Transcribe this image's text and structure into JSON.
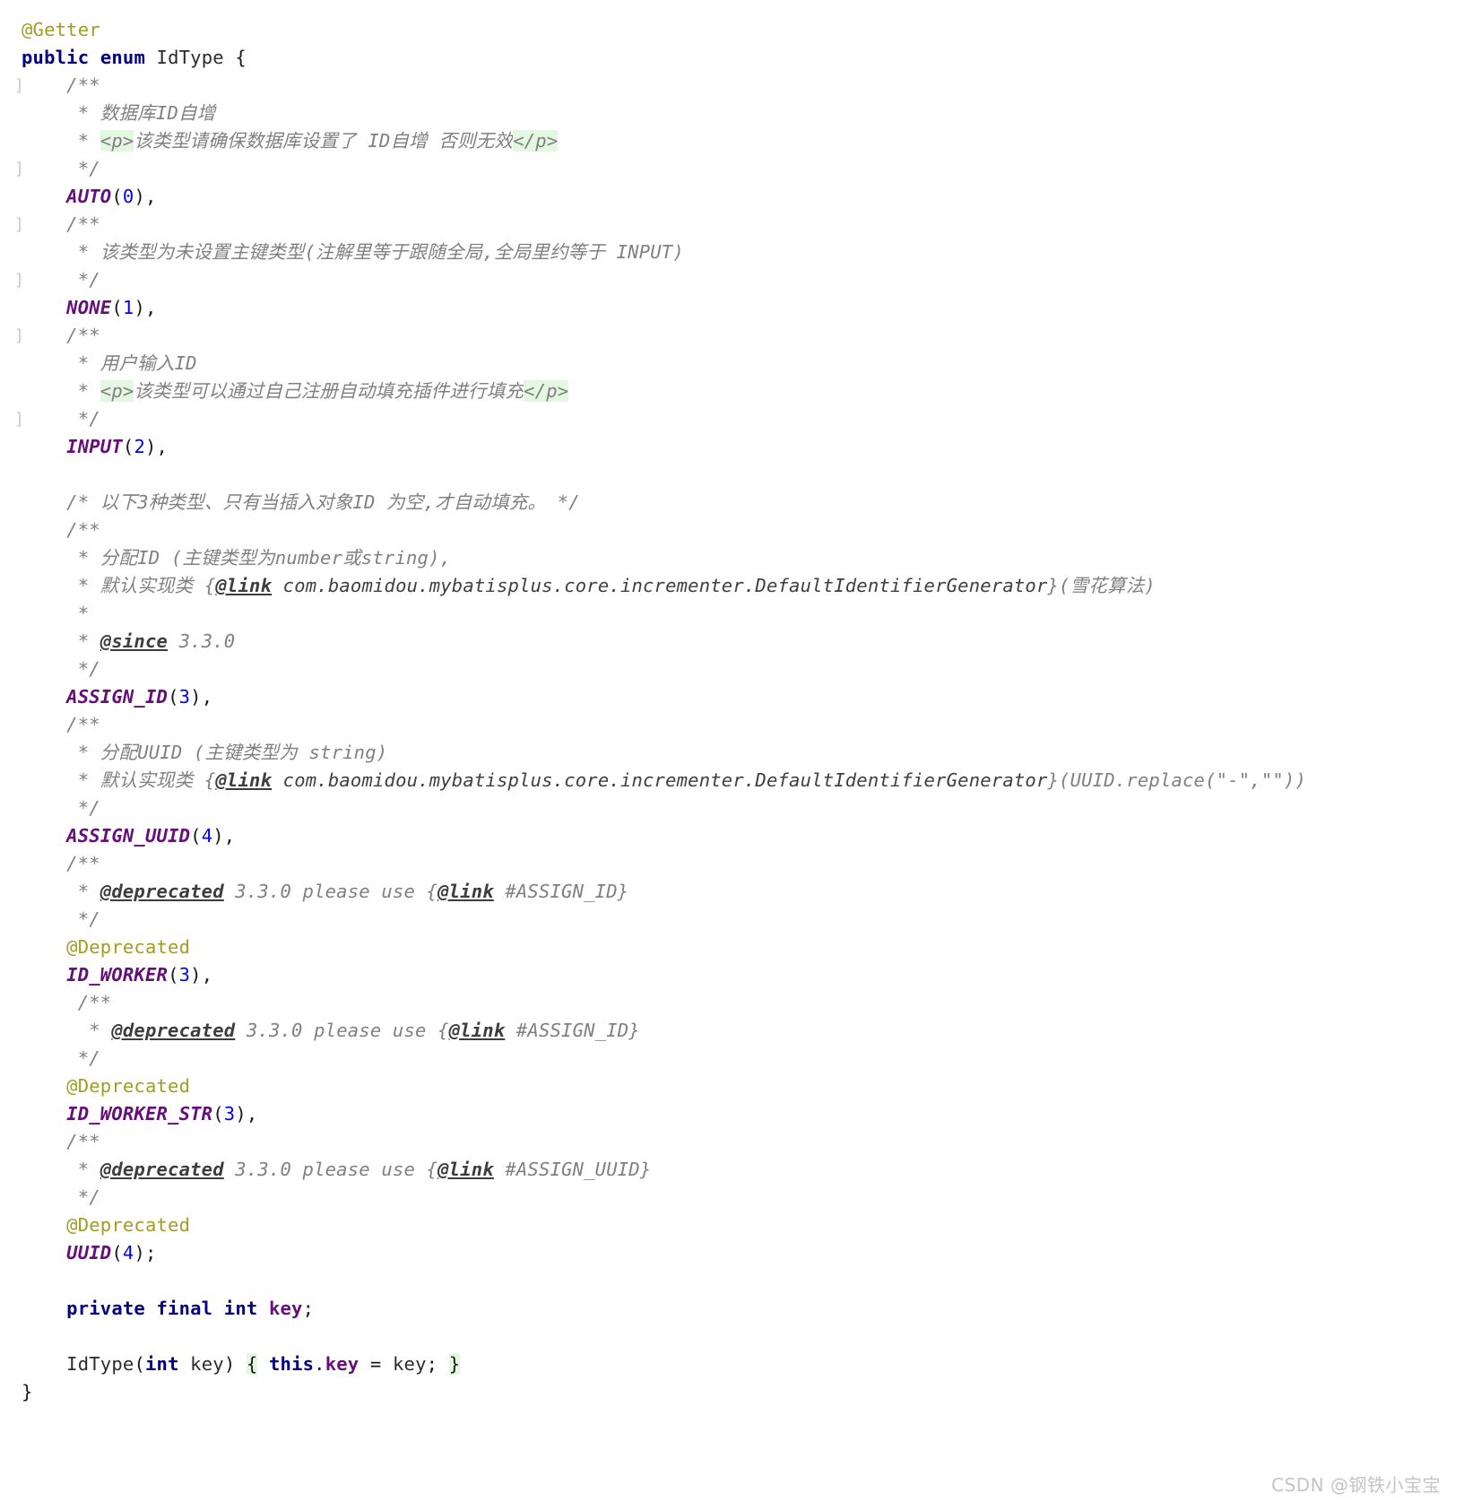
{
  "editor": {
    "language": "Java",
    "background_color": "#ffffff",
    "colors": {
      "keyword": "#000080",
      "annotation": "#9e9e20",
      "enum_constant": "#660e7a",
      "number": "#0000ff",
      "comment": "#808080",
      "field": "#660e7a",
      "brace_match_highlight": "#e4f7e0",
      "fold_marker": "#c9c9c9",
      "watermark": "#c4c4c4"
    }
  },
  "watermark": "CSDN @钢铁小宝宝",
  "code_lines": [
    {
      "fold": "",
      "tokens": [
        {
          "t": "@Getter",
          "c": "ann"
        }
      ]
    },
    {
      "fold": "",
      "tokens": [
        {
          "t": "public",
          "c": "kw"
        },
        {
          "t": " "
        },
        {
          "t": "enum",
          "c": "kw"
        },
        {
          "t": " "
        },
        {
          "t": "IdType",
          "c": "cls"
        },
        {
          "t": " "
        },
        {
          "t": "{",
          "c": "punc"
        }
      ]
    },
    {
      "fold": "]",
      "tokens": [
        {
          "t": "    "
        },
        {
          "t": "/**",
          "c": "cmt"
        }
      ]
    },
    {
      "fold": "",
      "tokens": [
        {
          "t": "     * ",
          "c": "cmt"
        },
        {
          "t": "数据库ID自增",
          "c": "cmt"
        }
      ]
    },
    {
      "fold": "",
      "tokens": [
        {
          "t": "     * ",
          "c": "cmt"
        },
        {
          "t": "<p>",
          "c": "cmt hl"
        },
        {
          "t": "该类型请确保数据库设置了 ID自增 否则无效",
          "c": "cmt"
        },
        {
          "t": "</p>",
          "c": "cmt hl"
        }
      ]
    },
    {
      "fold": "]",
      "tokens": [
        {
          "t": "     */",
          "c": "cmt"
        }
      ]
    },
    {
      "fold": "",
      "tokens": [
        {
          "t": "    "
        },
        {
          "t": "AUTO",
          "c": "enumc"
        },
        {
          "t": "(",
          "c": "punc"
        },
        {
          "t": "0",
          "c": "num"
        },
        {
          "t": "),",
          "c": "punc"
        }
      ]
    },
    {
      "fold": "]",
      "tokens": [
        {
          "t": "    "
        },
        {
          "t": "/**",
          "c": "cmt"
        }
      ]
    },
    {
      "fold": "",
      "tokens": [
        {
          "t": "     * ",
          "c": "cmt"
        },
        {
          "t": "该类型为未设置主键类型(注解里等于跟随全局,全局里约等于 INPUT)",
          "c": "cmt"
        }
      ]
    },
    {
      "fold": "]",
      "tokens": [
        {
          "t": "     */",
          "c": "cmt"
        }
      ]
    },
    {
      "fold": "",
      "tokens": [
        {
          "t": "    "
        },
        {
          "t": "NONE",
          "c": "enumc"
        },
        {
          "t": "(",
          "c": "punc"
        },
        {
          "t": "1",
          "c": "num"
        },
        {
          "t": "),",
          "c": "punc"
        }
      ]
    },
    {
      "fold": "]",
      "tokens": [
        {
          "t": "    "
        },
        {
          "t": "/**",
          "c": "cmt"
        }
      ]
    },
    {
      "fold": "",
      "tokens": [
        {
          "t": "     * ",
          "c": "cmt"
        },
        {
          "t": "用户输入ID",
          "c": "cmt"
        }
      ]
    },
    {
      "fold": "",
      "tokens": [
        {
          "t": "     * ",
          "c": "cmt"
        },
        {
          "t": "<p>",
          "c": "cmt hl"
        },
        {
          "t": "该类型可以通过自己注册自动填充插件进行填充",
          "c": "cmt"
        },
        {
          "t": "</p>",
          "c": "cmt hl"
        }
      ]
    },
    {
      "fold": "]",
      "tokens": [
        {
          "t": "     */",
          "c": "cmt"
        }
      ]
    },
    {
      "fold": "",
      "tokens": [
        {
          "t": "    "
        },
        {
          "t": "INPUT",
          "c": "enumc"
        },
        {
          "t": "(",
          "c": "punc"
        },
        {
          "t": "2",
          "c": "num"
        },
        {
          "t": "),",
          "c": "punc"
        }
      ]
    },
    {
      "fold": "",
      "tokens": [
        {
          "t": " "
        }
      ]
    },
    {
      "fold": "",
      "tokens": [
        {
          "t": "    /* 以下3种类型、只有当插入对象ID 为空,才自动填充。 */",
          "c": "cmt"
        }
      ]
    },
    {
      "fold": "",
      "tokens": [
        {
          "t": "    /**",
          "c": "cmt"
        }
      ]
    },
    {
      "fold": "",
      "tokens": [
        {
          "t": "     * ",
          "c": "cmt"
        },
        {
          "t": "分配ID (主键类型为number或string),",
          "c": "cmt"
        }
      ]
    },
    {
      "fold": "",
      "tokens": [
        {
          "t": "     * ",
          "c": "cmt"
        },
        {
          "t": "默认实现类 {",
          "c": "cmt"
        },
        {
          "t": "@link",
          "c": "cmtTag"
        },
        {
          "t": " com.baomidou.mybatisplus.core.incrementer.DefaultIdentifierGenerator",
          "c": "cmtCode"
        },
        {
          "t": "}(雪花算法)",
          "c": "cmt"
        }
      ]
    },
    {
      "fold": "",
      "tokens": [
        {
          "t": "     *",
          "c": "cmt"
        }
      ]
    },
    {
      "fold": "",
      "tokens": [
        {
          "t": "     * ",
          "c": "cmt"
        },
        {
          "t": "@since",
          "c": "cmtTag"
        },
        {
          "t": " 3.3.0",
          "c": "cmt"
        }
      ]
    },
    {
      "fold": "",
      "tokens": [
        {
          "t": "     */",
          "c": "cmt"
        }
      ]
    },
    {
      "fold": "",
      "tokens": [
        {
          "t": "    "
        },
        {
          "t": "ASSIGN_ID",
          "c": "enumc"
        },
        {
          "t": "(",
          "c": "punc"
        },
        {
          "t": "3",
          "c": "num"
        },
        {
          "t": "),",
          "c": "punc"
        }
      ]
    },
    {
      "fold": "",
      "tokens": [
        {
          "t": "    /**",
          "c": "cmt"
        }
      ]
    },
    {
      "fold": "",
      "tokens": [
        {
          "t": "     * ",
          "c": "cmt"
        },
        {
          "t": "分配UUID (主键类型为 string)",
          "c": "cmt"
        }
      ]
    },
    {
      "fold": "",
      "tokens": [
        {
          "t": "     * ",
          "c": "cmt"
        },
        {
          "t": "默认实现类 {",
          "c": "cmt"
        },
        {
          "t": "@link",
          "c": "cmtTag"
        },
        {
          "t": " com.baomidou.mybatisplus.core.incrementer.DefaultIdentifierGenerator",
          "c": "cmtCode"
        },
        {
          "t": "}(UUID.replace(\"-\",\"\"))",
          "c": "cmt"
        }
      ]
    },
    {
      "fold": "",
      "tokens": [
        {
          "t": "     */",
          "c": "cmt"
        }
      ]
    },
    {
      "fold": "",
      "tokens": [
        {
          "t": "    "
        },
        {
          "t": "ASSIGN_UUID",
          "c": "enumc"
        },
        {
          "t": "(",
          "c": "punc"
        },
        {
          "t": "4",
          "c": "num"
        },
        {
          "t": "),",
          "c": "punc"
        }
      ]
    },
    {
      "fold": "",
      "tokens": [
        {
          "t": "    /**",
          "c": "cmt"
        }
      ]
    },
    {
      "fold": "",
      "tokens": [
        {
          "t": "     * ",
          "c": "cmt"
        },
        {
          "t": "@deprecated",
          "c": "cmtTag"
        },
        {
          "t": " 3.3.0 please use {",
          "c": "cmt"
        },
        {
          "t": "@link",
          "c": "cmtTag"
        },
        {
          "t": " #ASSIGN_ID}",
          "c": "cmt"
        }
      ]
    },
    {
      "fold": "",
      "tokens": [
        {
          "t": "     */",
          "c": "cmt"
        }
      ]
    },
    {
      "fold": "",
      "tokens": [
        {
          "t": "    "
        },
        {
          "t": "@Deprecated",
          "c": "ann"
        }
      ]
    },
    {
      "fold": "",
      "tokens": [
        {
          "t": "    "
        },
        {
          "t": "ID_WORKER",
          "c": "enumc"
        },
        {
          "t": "(",
          "c": "punc"
        },
        {
          "t": "3",
          "c": "num"
        },
        {
          "t": "),",
          "c": "punc"
        }
      ]
    },
    {
      "fold": "",
      "tokens": [
        {
          "t": "     /**",
          "c": "cmt"
        }
      ]
    },
    {
      "fold": "",
      "tokens": [
        {
          "t": "      * ",
          "c": "cmt"
        },
        {
          "t": "@deprecated",
          "c": "cmtTag"
        },
        {
          "t": " 3.3.0 please use {",
          "c": "cmt"
        },
        {
          "t": "@link",
          "c": "cmtTag"
        },
        {
          "t": " #ASSIGN_ID}",
          "c": "cmt"
        }
      ]
    },
    {
      "fold": "",
      "tokens": [
        {
          "t": "     */",
          "c": "cmt"
        }
      ]
    },
    {
      "fold": "",
      "tokens": [
        {
          "t": "    "
        },
        {
          "t": "@Deprecated",
          "c": "ann"
        }
      ]
    },
    {
      "fold": "",
      "tokens": [
        {
          "t": "    "
        },
        {
          "t": "ID_WORKER_STR",
          "c": "enumc"
        },
        {
          "t": "(",
          "c": "punc"
        },
        {
          "t": "3",
          "c": "num"
        },
        {
          "t": "),",
          "c": "punc"
        }
      ]
    },
    {
      "fold": "",
      "tokens": [
        {
          "t": "    /**",
          "c": "cmt"
        }
      ]
    },
    {
      "fold": "",
      "tokens": [
        {
          "t": "     * ",
          "c": "cmt"
        },
        {
          "t": "@deprecated",
          "c": "cmtTag"
        },
        {
          "t": " 3.3.0 please use {",
          "c": "cmt"
        },
        {
          "t": "@link",
          "c": "cmtTag"
        },
        {
          "t": " #ASSIGN_UUID}",
          "c": "cmt"
        }
      ]
    },
    {
      "fold": "",
      "tokens": [
        {
          "t": "     */",
          "c": "cmt"
        }
      ]
    },
    {
      "fold": "",
      "tokens": [
        {
          "t": "    "
        },
        {
          "t": "@Deprecated",
          "c": "ann"
        }
      ]
    },
    {
      "fold": "",
      "tokens": [
        {
          "t": "    "
        },
        {
          "t": "UUID",
          "c": "enumc"
        },
        {
          "t": "(",
          "c": "punc"
        },
        {
          "t": "4",
          "c": "num"
        },
        {
          "t": ");",
          "c": "punc"
        }
      ]
    },
    {
      "fold": "",
      "tokens": [
        {
          "t": " "
        }
      ]
    },
    {
      "fold": "",
      "tokens": [
        {
          "t": "    "
        },
        {
          "t": "private",
          "c": "kw"
        },
        {
          "t": " "
        },
        {
          "t": "final",
          "c": "kw"
        },
        {
          "t": " "
        },
        {
          "t": "int",
          "c": "kw"
        },
        {
          "t": " "
        },
        {
          "t": "key",
          "c": "field"
        },
        {
          "t": ";",
          "c": "punc"
        }
      ]
    },
    {
      "fold": "",
      "tokens": [
        {
          "t": " "
        }
      ]
    },
    {
      "fold": "",
      "tokens": [
        {
          "t": "    "
        },
        {
          "t": "IdType",
          "c": "ident"
        },
        {
          "t": "(",
          "c": "punc"
        },
        {
          "t": "int",
          "c": "kw"
        },
        {
          "t": " "
        },
        {
          "t": "key",
          "c": "ident"
        },
        {
          "t": ") ",
          "c": "punc"
        },
        {
          "t": "{",
          "c": "punc hl"
        },
        {
          "t": " "
        },
        {
          "t": "this",
          "c": "kw"
        },
        {
          "t": ".",
          "c": "punc"
        },
        {
          "t": "key",
          "c": "field"
        },
        {
          "t": " = ",
          "c": "punc"
        },
        {
          "t": "key",
          "c": "ident"
        },
        {
          "t": "; ",
          "c": "punc"
        },
        {
          "t": "}",
          "c": "punc hl"
        }
      ]
    },
    {
      "fold": "",
      "tokens": [
        {
          "t": "}",
          "c": "punc"
        }
      ]
    }
  ]
}
